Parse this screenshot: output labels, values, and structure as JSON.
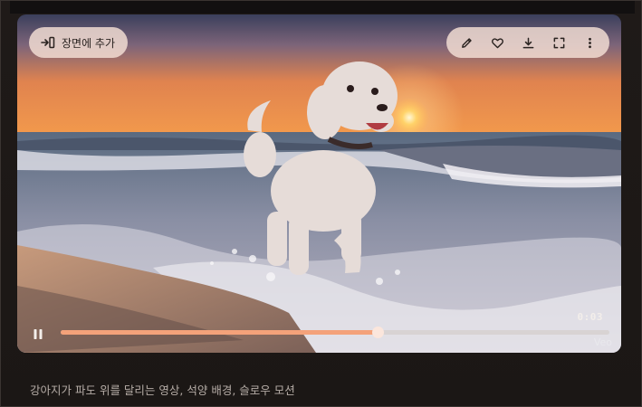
{
  "video": {
    "add_scene_label": "장면에 추가",
    "timestamp": "0:03",
    "progress": 0.577,
    "watermark": "Veo",
    "toolbar": {
      "icons": [
        "pencil-icon",
        "heart-icon",
        "download-icon",
        "fullscreen-icon",
        "more-vert-icon"
      ]
    },
    "accent_color": "#f4a27a"
  },
  "caption": "강아지가 파도 위를 달리는 영상, 석양 배경, 슬로우 모션"
}
